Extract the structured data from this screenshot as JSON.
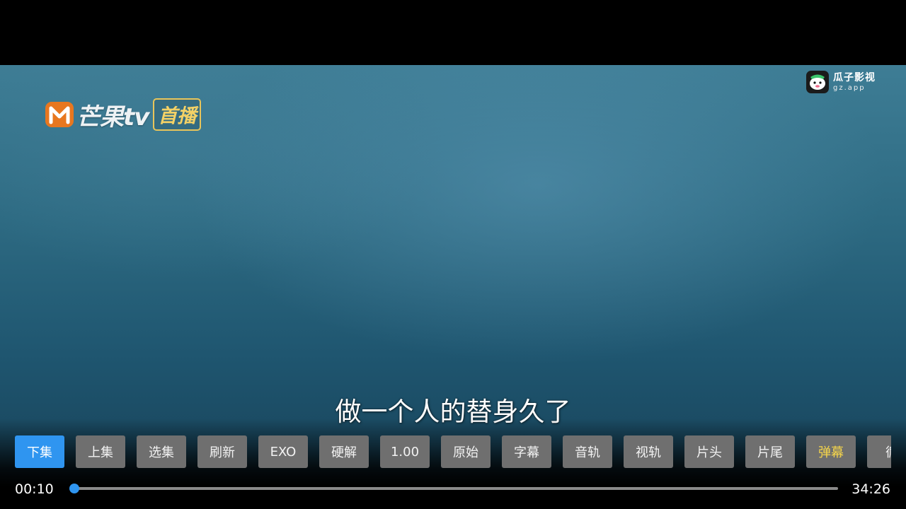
{
  "brand": {
    "name": "芒果tv",
    "badge": "首播",
    "icon": "mango-tv-logo-icon"
  },
  "watermark": {
    "title": "瓜子影视",
    "url": "gz.app",
    "icon": "guazi-mascot-icon"
  },
  "subtitle": "做一个人的替身久了",
  "controls": {
    "buttons": [
      {
        "label": "下集",
        "state": "active"
      },
      {
        "label": "上集"
      },
      {
        "label": "选集"
      },
      {
        "label": "刷新"
      },
      {
        "label": "EXO"
      },
      {
        "label": "硬解"
      },
      {
        "label": "1.00"
      },
      {
        "label": "原始"
      },
      {
        "label": "字幕"
      },
      {
        "label": "音轨"
      },
      {
        "label": "视轨"
      },
      {
        "label": "片头"
      },
      {
        "label": "片尾"
      },
      {
        "label": "弹幕",
        "state": "highlight"
      },
      {
        "label": "循"
      }
    ]
  },
  "playback": {
    "current_time": "00:10",
    "total_time": "34:26",
    "progress_fraction": 0.005
  },
  "colors": {
    "accent": "#2f95f0",
    "danmaku_text": "#f4d44b",
    "button_bg": "#6f6f6f",
    "brand_badge": "#f3d166"
  }
}
